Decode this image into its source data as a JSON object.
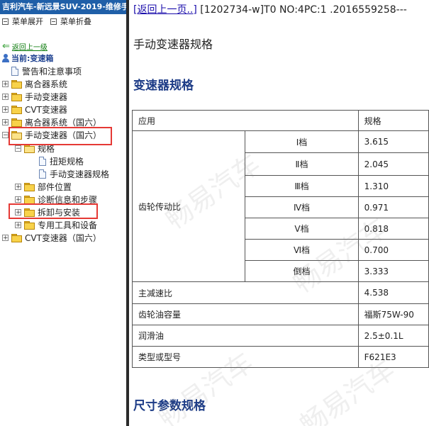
{
  "app_title": "吉利汽车-新远景SUV-2019-维修手",
  "menu": {
    "expand_label": "菜单展开",
    "collapse_label": "菜单折叠"
  },
  "back_link": "返回上一级",
  "current_label": "当前:变速箱",
  "tree": [
    {
      "label": "警告和注意事项"
    },
    {
      "label": "离合器系统"
    },
    {
      "label": "手动变速器"
    },
    {
      "label": "CVT变速器"
    },
    {
      "label": "离合器系统（国六）"
    },
    {
      "label": "手动变速器（国六）"
    },
    {
      "label": "规格"
    },
    {
      "label": "扭矩规格"
    },
    {
      "label": "手动变速器规格"
    },
    {
      "label": "部件位置"
    },
    {
      "label": "诊断信息和步骤"
    },
    {
      "label": "拆卸与安装"
    },
    {
      "label": "专用工具和设备"
    },
    {
      "label": "CVT变速器（国六）"
    }
  ],
  "content": {
    "return_link": "[返回上一页..]",
    "doc_id": " [1202734-w]T0 NO:4PC:1 .2016559258---",
    "doc_title": "手动变速器规格",
    "section1": "变速器规格",
    "section2": "尺寸参数规格",
    "table": {
      "header": {
        "col1": "应用",
        "col3": "规格"
      },
      "gear_group": "齿轮传动比",
      "gears": [
        {
          "name": "Ⅰ档",
          "value": "3.615"
        },
        {
          "name": "Ⅱ档",
          "value": "2.045"
        },
        {
          "name": "Ⅲ档",
          "value": "1.310"
        },
        {
          "name": "Ⅳ档",
          "value": "0.971"
        },
        {
          "name": "Ⅴ档",
          "value": "0.818"
        },
        {
          "name": "Ⅵ档",
          "value": "0.700"
        },
        {
          "name": "倒档",
          "value": "3.333"
        }
      ],
      "rows": [
        {
          "name": "主减速比",
          "value": "4.538"
        },
        {
          "name": "齿轮油容量",
          "value": "福斯75W-90"
        },
        {
          "name": "润滑油",
          "value": "2.5±0.1L"
        },
        {
          "name": "类型或型号",
          "value": "F621E3"
        }
      ]
    },
    "watermark": "畅易汽车"
  },
  "colors": {
    "title_bar": "#1f5fa8",
    "heading": "#1c3b86",
    "highlight_box": "#e53935"
  }
}
